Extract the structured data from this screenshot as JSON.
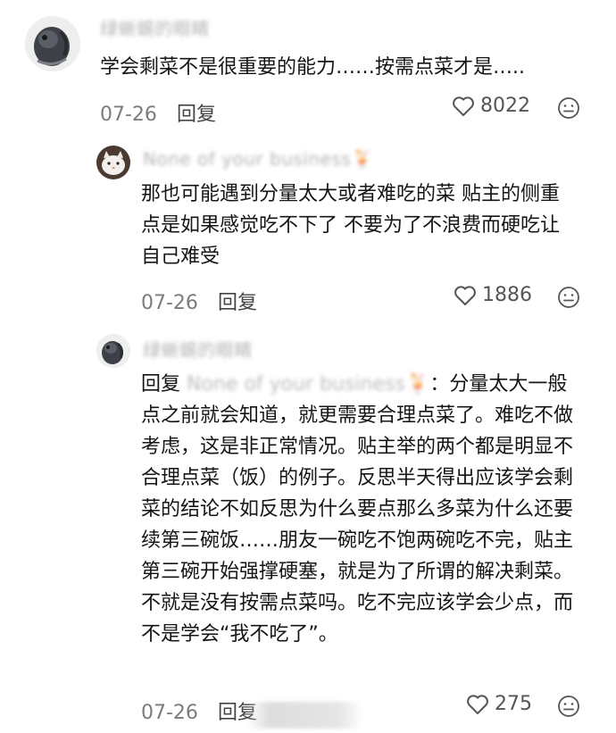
{
  "comments": [
    {
      "username": "绿蜥蜴的眼睛",
      "text": "学会剩菜不是很重要的能力……按需点菜才是…..",
      "date": "07-26",
      "reply_label": "回复",
      "likes": "8022"
    },
    {
      "username": "None of your business🍹",
      "text": "那也可能遇到分量太大或者难吃的菜 贴主的侧重点是如果感觉吃不下了 不要为了不浪费而硬吃让自己难受",
      "date": "07-26",
      "reply_label": "回复",
      "likes": "1886"
    },
    {
      "username": "绿蜥蜴的眼睛",
      "reply_prefix": "回复",
      "reply_target": "None of your business🍹",
      "reply_colon": "：",
      "text": "分量太大一般点之前就会知道，就更需要合理点菜了。难吃不做考虑，这是非正常情况。贴主举的两个都是明显不合理点菜（饭）的例子。反思半天得出应该学会剩菜的结论不如反思为什么要点那么多菜为什么还要续第三碗饭……朋友一碗吃不饱两碗吃不完，贴主第三碗开始强撑硬塞，就是为了所谓的解决剩菜。不就是没有按需点菜吗。吃不完应该学会少点，而不是学会“我不吃了”。",
      "date": "07-26",
      "reply_label": "回复",
      "likes": "275"
    }
  ],
  "icons": {
    "like": "heart-outline-icon",
    "emoji": "emoji-face-icon"
  },
  "colors": {
    "text": "#151515",
    "meta": "#7c7c7c",
    "username": "#9a9a9a"
  }
}
